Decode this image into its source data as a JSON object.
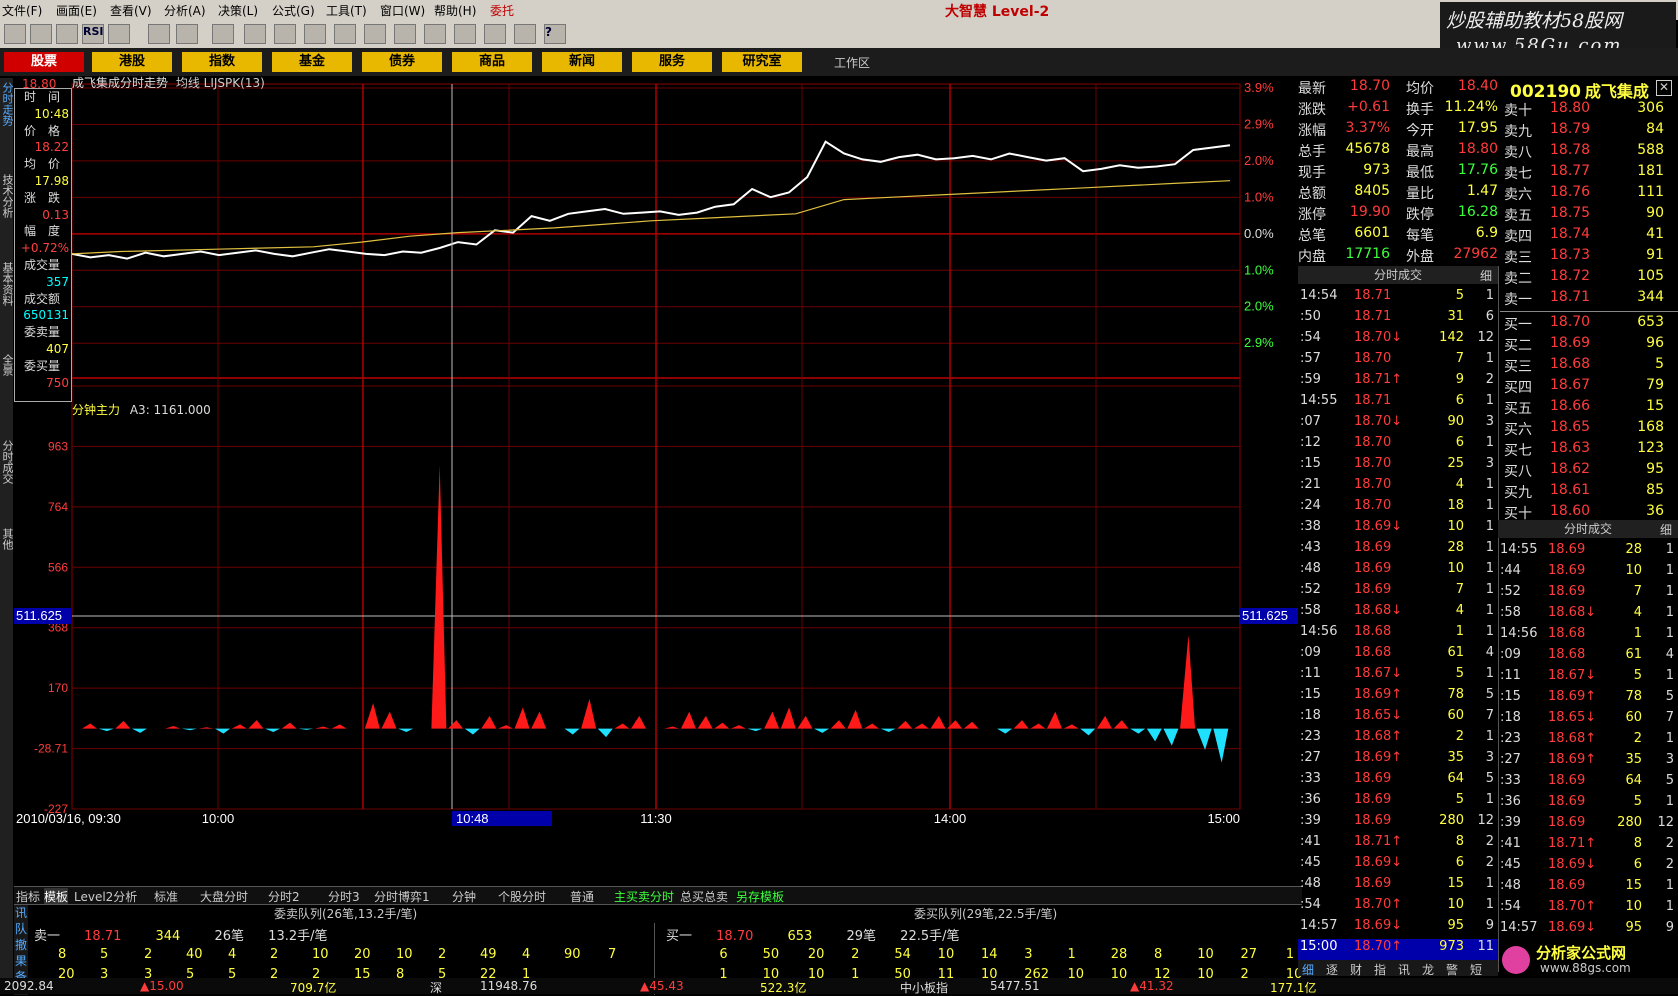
{
  "menu": [
    "文件(F)",
    "画面(E)",
    "查看(V)",
    "分析(A)",
    "决策(L)",
    "公式(G)",
    "工具(T)",
    "窗口(W)",
    "帮助(H)",
    "委托"
  ],
  "brand": "大智慧 Level-2",
  "watermark": {
    "line1": "炒股辅助教材58股网",
    "line2": "www.58Gu.com"
  },
  "tabs": [
    "股票",
    "港股",
    "指数",
    "基金",
    "债券",
    "商品",
    "新闻",
    "服务",
    "研究室"
  ],
  "workspace": "工作区",
  "left_tabs": [
    "分时走势",
    "技术分析",
    "基本资料",
    "全景",
    "分时成交",
    "其他"
  ],
  "chart_title": "成飞集成分时走势",
  "chart_title_extra": "均线 LIJSPK(13)",
  "info_box": [
    {
      "k": "时　间",
      "v": "10:48",
      "c": "vy"
    },
    {
      "k": "价　格",
      "v": "18.22",
      "c": "vr"
    },
    {
      "k": "均　价",
      "v": "17.98",
      "c": "vy"
    },
    {
      "k": "涨　跌",
      "v": "0.13",
      "c": "vr"
    },
    {
      "k": "幅　度",
      "v": "+0.72%",
      "c": "vr"
    },
    {
      "k": "成交量",
      "v": "357",
      "c": "vc"
    },
    {
      "k": "成交额",
      "v": "650131",
      "c": "vc"
    },
    {
      "k": "委卖量",
      "v": "407",
      "c": "vy"
    },
    {
      "k": "委买量",
      "v": "750",
      "c": "vr"
    }
  ],
  "pct_labels": [
    "3.9%",
    "2.9%",
    "2.0%",
    "1.0%",
    "0.0%",
    "1.0%",
    "2.0%",
    "2.9%"
  ],
  "price_top_label": "18.80",
  "indicator_title": "分钟主力",
  "indicator_value": "A3: 1161.000",
  "indicator_axis": [
    "1161",
    "963",
    "764",
    "566",
    "368",
    "170",
    "-28.71",
    "-227"
  ],
  "cursor_value": "511.625",
  "time_labels": [
    "2010/03/16, 09:30",
    "10:00",
    "10:48",
    "11:30",
    "14:00",
    "15:00"
  ],
  "price_line": [
    0.4,
    0.37,
    0.39,
    0.36,
    0.41,
    0.38,
    0.4,
    0.42,
    0.39,
    0.41,
    0.43,
    0.4,
    0.38,
    0.41,
    0.44,
    0.42,
    0.4,
    0.39,
    0.42,
    0.41,
    0.45,
    0.5,
    0.48,
    0.6,
    0.58,
    0.72,
    0.68,
    0.74,
    0.76,
    0.78,
    0.74,
    0.75,
    0.76,
    0.73,
    0.75,
    0.8,
    0.82,
    0.95,
    0.88,
    0.92,
    1.05,
    1.35,
    1.25,
    1.2,
    1.18,
    1.22,
    1.24,
    1.2,
    1.21,
    1.23,
    1.2,
    1.25,
    1.22,
    1.19,
    1.21,
    1.1,
    1.12,
    1.15,
    1.13,
    1.14,
    1.16,
    1.28,
    1.3,
    1.32
  ],
  "avg_line": [
    0.4,
    0.42,
    0.43,
    0.44,
    0.45,
    0.46,
    0.5,
    0.55,
    0.58,
    0.6,
    0.62,
    0.65,
    0.68,
    0.7,
    0.72,
    0.74,
    0.86,
    0.88,
    0.9,
    0.92,
    0.94,
    0.96,
    0.98,
    1.0,
    1.02
  ],
  "volume_bars": [
    12,
    -6,
    18,
    -10,
    0,
    6,
    -4,
    3,
    -12,
    10,
    20,
    -8,
    14,
    -3,
    5,
    10,
    0,
    60,
    40,
    -8,
    0,
    620,
    20,
    -14,
    30,
    8,
    50,
    40,
    0,
    -14,
    70,
    -20,
    12,
    30,
    0,
    5,
    40,
    30,
    14,
    8,
    -6,
    40,
    50,
    30,
    -10,
    20,
    44,
    12,
    -8,
    18,
    12,
    30,
    20,
    16,
    0,
    -12,
    20,
    12,
    40,
    10,
    -16,
    30,
    20,
    -12,
    -30,
    -40,
    220,
    -50,
    -80
  ],
  "queues": {
    "sell_header": "委卖队列(26笔,13.2手/笔)",
    "buy_header": "委买队列(29笔,22.5手/笔)",
    "sell1": {
      "label": "卖一",
      "price": "18.71",
      "vol": "344",
      "cnt": "26笔",
      "avg": "13.2手/笔"
    },
    "buy1": {
      "label": "买一",
      "price": "18.70",
      "vol": "653",
      "cnt": "29笔",
      "avg": "22.5手/笔"
    },
    "sell_rows": [
      [
        "8",
        "5",
        "2",
        "40",
        "4",
        "2",
        "10",
        "20",
        "10",
        "2",
        "49",
        "4",
        "90",
        "7"
      ],
      [
        "20",
        "3",
        "3",
        "5",
        "5",
        "2",
        "2",
        "15",
        "8",
        "5",
        "22",
        "1"
      ]
    ],
    "buy_rows": [
      [
        "6",
        "50",
        "20",
        "2",
        "54",
        "10",
        "14",
        "3",
        "1",
        "28",
        "8",
        "10",
        "27",
        "1"
      ],
      [
        "1",
        "10",
        "10",
        "1",
        "50",
        "11",
        "10",
        "262",
        "10",
        "10",
        "12",
        "10",
        "2",
        "10"
      ]
    ]
  },
  "sub_bar": [
    "指标",
    "模板",
    "Level2分析",
    "标准",
    "大盘分时",
    "分时2",
    "分时3",
    "分时博弈1",
    "分钟",
    "个股分时",
    "普通",
    "主买卖分时",
    "总买总卖",
    "另存模板"
  ],
  "quote": [
    {
      "a": "最新",
      "b": "18.70",
      "bc": "red",
      "c": "均价",
      "d": "18.40",
      "dc": "red"
    },
    {
      "a": "涨跌",
      "b": "+0.61",
      "bc": "red",
      "c": "换手",
      "d": "11.24%",
      "dc": "yel"
    },
    {
      "a": "涨幅",
      "b": "3.37%",
      "bc": "red",
      "c": "今开",
      "d": "17.95",
      "dc": "yel"
    },
    {
      "a": "总手",
      "b": "45678",
      "bc": "yel",
      "c": "最高",
      "d": "18.80",
      "dc": "red"
    },
    {
      "a": "现手",
      "b": "973",
      "bc": "yel",
      "c": "最低",
      "d": "17.76",
      "dc": "grn"
    },
    {
      "a": "总额",
      "b": "8405",
      "bc": "yel",
      "c": "量比",
      "d": "1.47",
      "dc": "yel"
    },
    {
      "a": "涨停",
      "b": "19.90",
      "bc": "red",
      "c": "跌停",
      "d": "16.28",
      "dc": "grn"
    },
    {
      "a": "总笔",
      "b": "6601",
      "bc": "yel",
      "c": "每笔",
      "d": "6.9",
      "dc": "yel"
    },
    {
      "a": "内盘",
      "b": "17716",
      "bc": "grn",
      "c": "外盘",
      "d": "27962",
      "dc": "red"
    }
  ],
  "stock": {
    "code": "002190",
    "name": "成飞集成"
  },
  "asks": [
    {
      "n": "卖十",
      "p": "18.80",
      "v": "306"
    },
    {
      "n": "卖九",
      "p": "18.79",
      "v": "84"
    },
    {
      "n": "卖八",
      "p": "18.78",
      "v": "588"
    },
    {
      "n": "卖七",
      "p": "18.77",
      "v": "181"
    },
    {
      "n": "卖六",
      "p": "18.76",
      "v": "111"
    },
    {
      "n": "卖五",
      "p": "18.75",
      "v": "90"
    },
    {
      "n": "卖四",
      "p": "18.74",
      "v": "41"
    },
    {
      "n": "卖三",
      "p": "18.73",
      "v": "91"
    },
    {
      "n": "卖二",
      "p": "18.72",
      "v": "105"
    },
    {
      "n": "卖一",
      "p": "18.71",
      "v": "344"
    }
  ],
  "bids": [
    {
      "n": "买一",
      "p": "18.70",
      "v": "653"
    },
    {
      "n": "买二",
      "p": "18.69",
      "v": "96"
    },
    {
      "n": "买三",
      "p": "18.68",
      "v": "5"
    },
    {
      "n": "买四",
      "p": "18.67",
      "v": "79"
    },
    {
      "n": "买五",
      "p": "18.66",
      "v": "15"
    },
    {
      "n": "买六",
      "p": "18.65",
      "v": "168"
    },
    {
      "n": "买七",
      "p": "18.63",
      "v": "123"
    },
    {
      "n": "买八",
      "p": "18.62",
      "v": "95"
    },
    {
      "n": "买九",
      "p": "18.61",
      "v": "85"
    },
    {
      "n": "买十",
      "p": "18.60",
      "v": "36"
    }
  ],
  "ticks_header": "分时成交",
  "ticks_detail": "细",
  "ticks": [
    {
      "t": "14:54",
      "p": "18.71",
      "pc": "red",
      "v": "5",
      "c": "1"
    },
    {
      "t": ":50",
      "p": "18.71",
      "pc": "red",
      "v": "31",
      "c": "6"
    },
    {
      "t": ":54",
      "p": "18.70↓",
      "pc": "red",
      "v": "142",
      "c": "12"
    },
    {
      "t": ":57",
      "p": "18.70",
      "pc": "red",
      "v": "7",
      "c": "1"
    },
    {
      "t": ":59",
      "p": "18.71↑",
      "pc": "red",
      "v": "9",
      "c": "2"
    },
    {
      "t": "14:55",
      "p": "18.71",
      "pc": "red",
      "v": "6",
      "c": "1"
    },
    {
      "t": ":07",
      "p": "18.70↓",
      "pc": "red",
      "v": "90",
      "c": "3"
    },
    {
      "t": ":12",
      "p": "18.70",
      "pc": "red",
      "v": "6",
      "c": "1"
    },
    {
      "t": ":15",
      "p": "18.70",
      "pc": "red",
      "v": "25",
      "c": "3"
    },
    {
      "t": ":21",
      "p": "18.70",
      "pc": "red",
      "v": "4",
      "c": "1"
    },
    {
      "t": ":24",
      "p": "18.70",
      "pc": "red",
      "v": "18",
      "c": "1"
    },
    {
      "t": ":38",
      "p": "18.69↓",
      "pc": "red",
      "v": "10",
      "c": "1"
    },
    {
      "t": ":43",
      "p": "18.69",
      "pc": "red",
      "v": "28",
      "c": "1"
    },
    {
      "t": ":48",
      "p": "18.69",
      "pc": "red",
      "v": "10",
      "c": "1"
    },
    {
      "t": ":52",
      "p": "18.69",
      "pc": "red",
      "v": "7",
      "c": "1"
    },
    {
      "t": ":58",
      "p": "18.68↓",
      "pc": "red",
      "v": "4",
      "c": "1"
    },
    {
      "t": "14:56",
      "p": "18.68",
      "pc": "red",
      "v": "1",
      "c": "1"
    },
    {
      "t": ":09",
      "p": "18.68",
      "pc": "red",
      "v": "61",
      "c": "4"
    },
    {
      "t": ":11",
      "p": "18.67↓",
      "pc": "red",
      "v": "5",
      "c": "1"
    },
    {
      "t": ":15",
      "p": "18.69↑",
      "pc": "red",
      "v": "78",
      "c": "5"
    },
    {
      "t": ":18",
      "p": "18.65↓",
      "pc": "red",
      "v": "60",
      "c": "7"
    },
    {
      "t": ":23",
      "p": "18.68↑",
      "pc": "red",
      "v": "2",
      "c": "1"
    },
    {
      "t": ":27",
      "p": "18.69↑",
      "pc": "red",
      "v": "35",
      "c": "3"
    },
    {
      "t": ":33",
      "p": "18.69",
      "pc": "red",
      "v": "64",
      "c": "5"
    },
    {
      "t": ":36",
      "p": "18.69",
      "pc": "red",
      "v": "5",
      "c": "1"
    },
    {
      "t": ":39",
      "p": "18.69",
      "pc": "red",
      "v": "280",
      "c": "12"
    },
    {
      "t": ":41",
      "p": "18.71↑",
      "pc": "red",
      "v": "8",
      "c": "2"
    },
    {
      "t": ":45",
      "p": "18.69↓",
      "pc": "red",
      "v": "6",
      "c": "2"
    },
    {
      "t": ":48",
      "p": "18.69",
      "pc": "red",
      "v": "15",
      "c": "1"
    },
    {
      "t": ":54",
      "p": "18.70↑",
      "pc": "red",
      "v": "10",
      "c": "1"
    },
    {
      "t": "14:57",
      "p": "18.69↓",
      "pc": "red",
      "v": "95",
      "c": "9"
    },
    {
      "t": "15:00",
      "p": "18.70↑",
      "pc": "red",
      "v": "973",
      "c": "11"
    }
  ],
  "right_ticks": [
    {
      "t": "14:55",
      "p": "18.69",
      "v": "28",
      "c": "1"
    },
    {
      "t": ":44",
      "p": "18.69",
      "v": "10",
      "c": "1"
    },
    {
      "t": ":52",
      "p": "18.69",
      "v": "7",
      "c": "1"
    },
    {
      "t": ":58",
      "p": "18.68↓",
      "v": "4",
      "c": "1"
    },
    {
      "t": "14:56",
      "p": "18.68",
      "v": "1",
      "c": "1"
    },
    {
      "t": ":09",
      "p": "18.68",
      "v": "61",
      "c": "4"
    },
    {
      "t": ":11",
      "p": "18.67↓",
      "v": "5",
      "c": "1"
    },
    {
      "t": ":15",
      "p": "18.69↑",
      "v": "78",
      "c": "5"
    },
    {
      "t": ":18",
      "p": "18.65↓",
      "v": "60",
      "c": "7"
    },
    {
      "t": ":23",
      "p": "18.68↑",
      "v": "2",
      "c": "1"
    },
    {
      "t": ":27",
      "p": "18.69↑",
      "v": "35",
      "c": "3"
    },
    {
      "t": ":33",
      "p": "18.69",
      "v": "64",
      "c": "5"
    },
    {
      "t": ":36",
      "p": "18.69",
      "v": "5",
      "c": "1"
    },
    {
      "t": ":39",
      "p": "18.69",
      "v": "280",
      "c": "12"
    },
    {
      "t": ":41",
      "p": "18.71↑",
      "v": "8",
      "c": "2"
    },
    {
      "t": ":45",
      "p": "18.69↓",
      "v": "6",
      "c": "2"
    },
    {
      "t": ":48",
      "p": "18.69",
      "v": "15",
      "c": "1"
    },
    {
      "t": ":54",
      "p": "18.70↑",
      "v": "10",
      "c": "1"
    },
    {
      "t": "14:57",
      "p": "18.69↓",
      "v": "95",
      "c": "9"
    }
  ],
  "bottom_tabs": [
    "细",
    "逐",
    "财",
    "指",
    "讯",
    "龙",
    "警",
    "短"
  ],
  "footer": {
    "logo": "分析家公式网",
    "logo_url": "www.88gs.com",
    "status": [
      "2092.84",
      "▲15.00",
      "709.7亿",
      "深",
      "11948.76",
      "▲45.43",
      "522.3亿",
      "中小板指",
      "5477.51",
      "▲41.32",
      "177.1亿"
    ]
  }
}
